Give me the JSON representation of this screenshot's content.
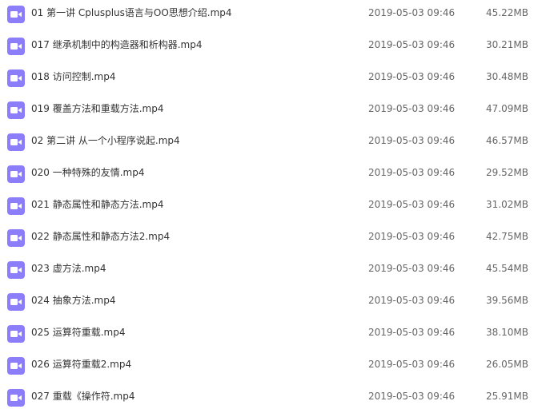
{
  "files": [
    {
      "name": "01 第一讲 Cplusplus语言与OO思想介绍.mp4",
      "date": "2019-05-03 09:46",
      "size": "45.22MB",
      "icon": "video-file-icon"
    },
    {
      "name": "017 继承机制中的构造器和析构器.mp4",
      "date": "2019-05-03 09:46",
      "size": "30.21MB",
      "icon": "video-file-icon"
    },
    {
      "name": "018 访问控制.mp4",
      "date": "2019-05-03 09:46",
      "size": "30.48MB",
      "icon": "video-file-icon"
    },
    {
      "name": "019 覆盖方法和重载方法.mp4",
      "date": "2019-05-03 09:46",
      "size": "47.09MB",
      "icon": "video-file-icon"
    },
    {
      "name": "02 第二讲 从一个小程序说起.mp4",
      "date": "2019-05-03 09:46",
      "size": "46.57MB",
      "icon": "video-file-icon"
    },
    {
      "name": "020 一种特殊的友情.mp4",
      "date": "2019-05-03 09:46",
      "size": "29.52MB",
      "icon": "video-file-icon"
    },
    {
      "name": "021 静态属性和静态方法.mp4",
      "date": "2019-05-03 09:46",
      "size": "31.02MB",
      "icon": "video-file-icon"
    },
    {
      "name": "022 静态属性和静态方法2.mp4",
      "date": "2019-05-03 09:46",
      "size": "42.75MB",
      "icon": "video-file-icon"
    },
    {
      "name": "023 虚方法.mp4",
      "date": "2019-05-03 09:46",
      "size": "45.54MB",
      "icon": "video-file-icon"
    },
    {
      "name": "024 抽象方法.mp4",
      "date": "2019-05-03 09:46",
      "size": "39.56MB",
      "icon": "video-file-icon"
    },
    {
      "name": "025 运算符重载.mp4",
      "date": "2019-05-03 09:46",
      "size": "38.10MB",
      "icon": "video-file-icon"
    },
    {
      "name": "026 运算符重载2.mp4",
      "date": "2019-05-03 09:46",
      "size": "26.05MB",
      "icon": "video-file-icon"
    },
    {
      "name": "027 重载《操作符.mp4",
      "date": "2019-05-03 09:46",
      "size": "25.91MB",
      "icon": "video-file-icon"
    }
  ],
  "colors": {
    "icon_bg": "#8c7dfa",
    "text": "#333333",
    "meta_text": "#666666"
  }
}
